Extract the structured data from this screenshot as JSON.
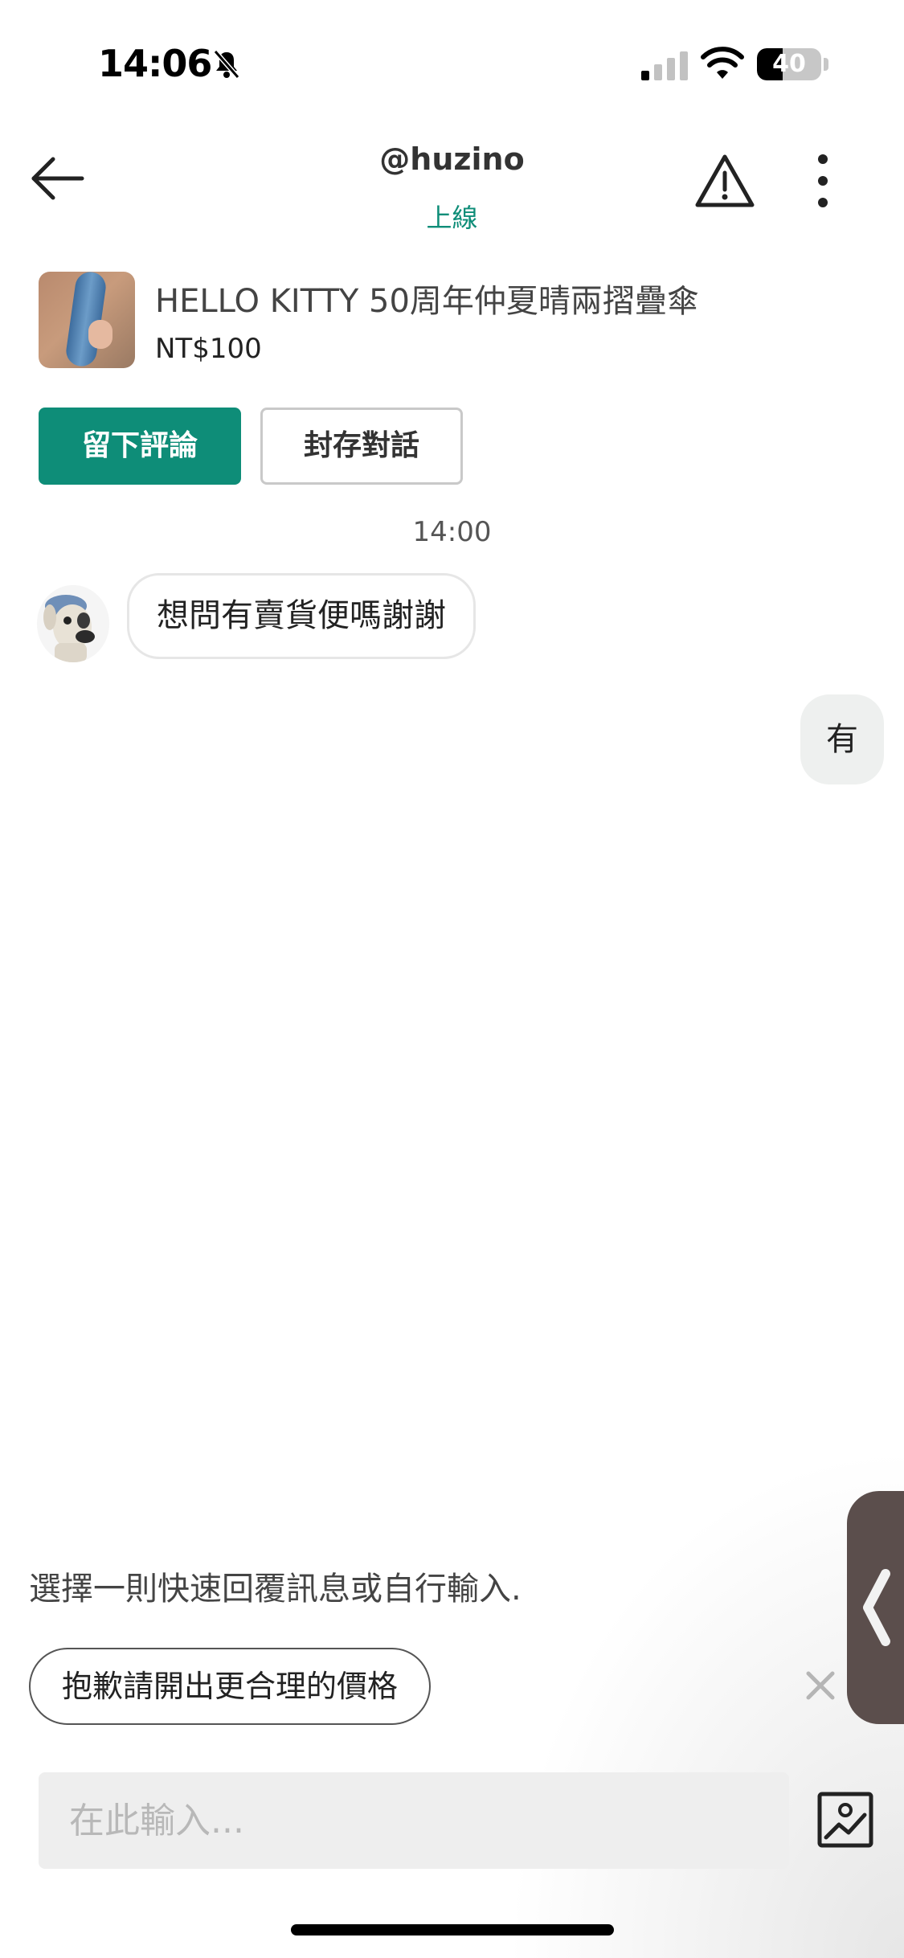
{
  "status_bar": {
    "time": "14:06",
    "battery": "40",
    "battery_level": 0.4
  },
  "header": {
    "title": "@huzino",
    "status": "上線"
  },
  "product": {
    "title": "HELLO KITTY 50周年仲夏晴兩摺疊傘",
    "price": "NT$100"
  },
  "actions": {
    "review_label": "留下評論",
    "archive_label": "封存對話"
  },
  "chat": {
    "time": "14:00",
    "incoming_message": "想問有賣貨便嗎謝謝",
    "outgoing_message": "有"
  },
  "quick_reply": {
    "hint": "選擇一則快速回覆訊息或自行輸入.",
    "chip_label": "抱歉請開出更合理的價格"
  },
  "composer": {
    "placeholder": "在此輸入..."
  },
  "icons": {
    "bell": "bell-slash-icon",
    "signal": "cellular-signal-icon",
    "wifi": "wifi-icon",
    "back": "arrow-left-icon",
    "warning": "warning-triangle-icon",
    "more": "more-vertical-icon",
    "close": "close-icon",
    "side": "chevron-left-icon",
    "image": "image-upload-icon"
  },
  "colors": {
    "accent": "#0e8d78",
    "side_tab": "#5b4e4c"
  }
}
